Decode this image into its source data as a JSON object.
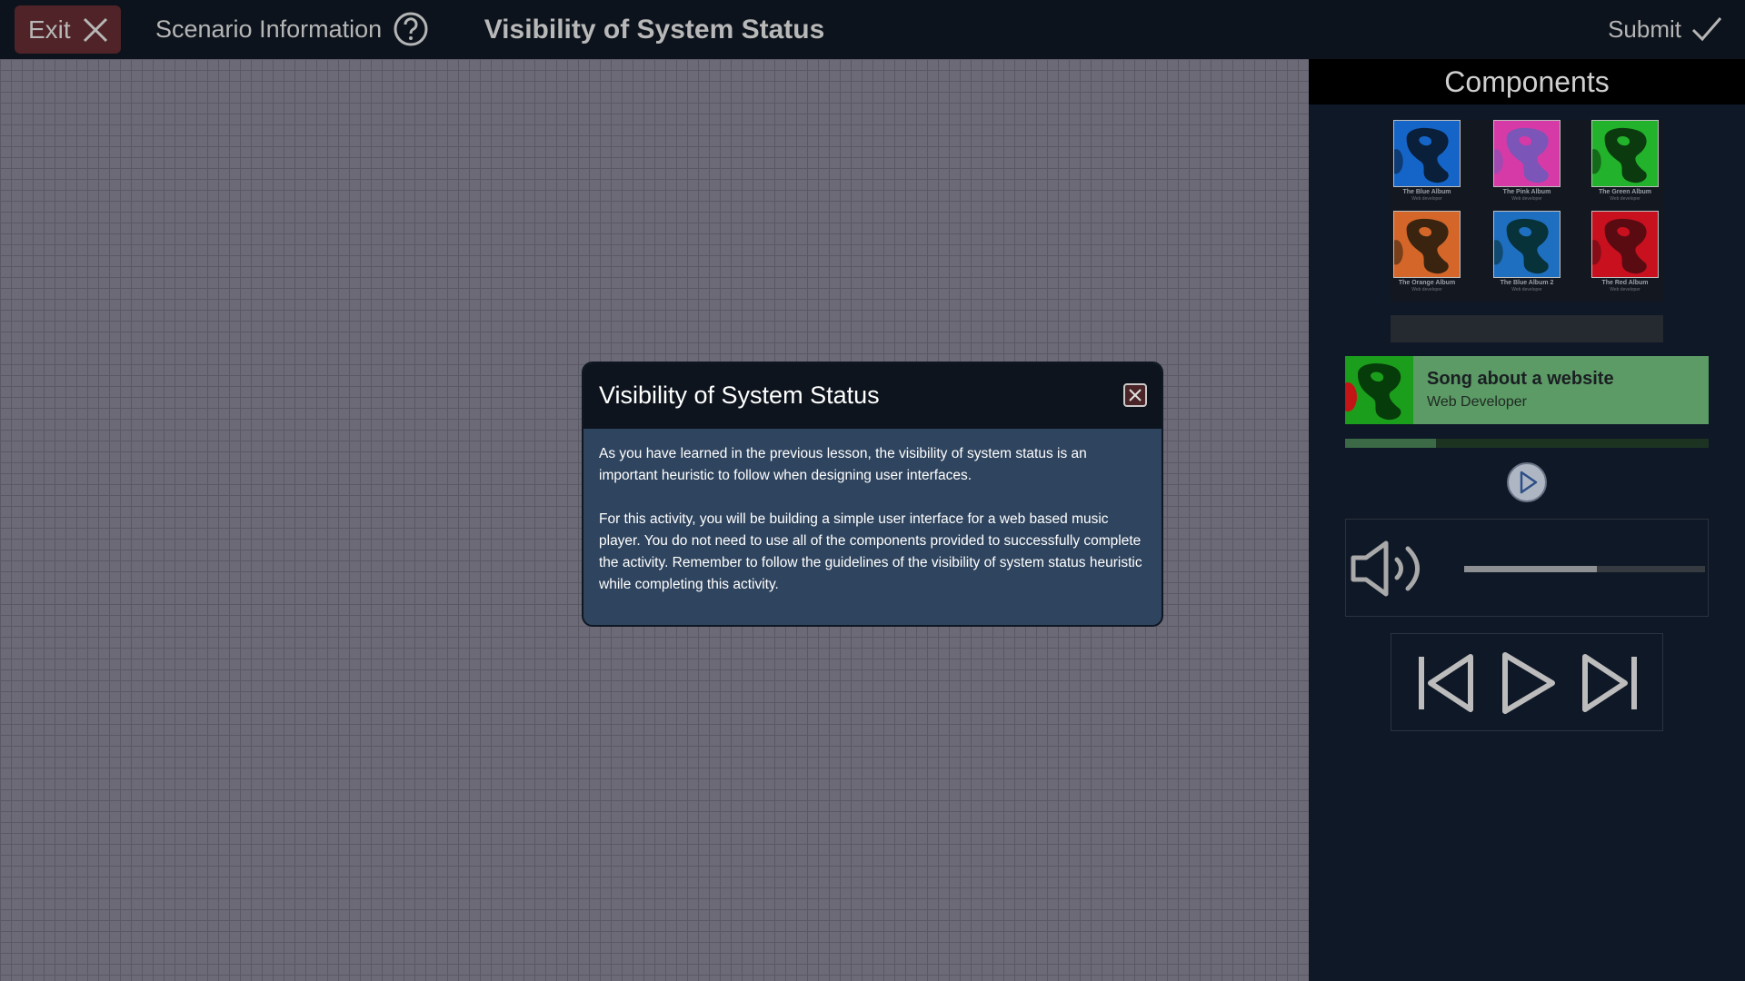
{
  "topbar": {
    "exit_label": "Exit",
    "scenario_label": "Scenario Information",
    "title": "Visibility of System Status",
    "submit_label": "Submit"
  },
  "panel": {
    "header": "Components",
    "albums": [
      {
        "title": "The Blue Album",
        "artist": "Web developer",
        "color": "#1565c8",
        "blob": "#0a1f3a"
      },
      {
        "title": "The Pink Album",
        "artist": "Web developer",
        "color": "#d63aa7",
        "blob": "#7b55b8"
      },
      {
        "title": "The Green Album",
        "artist": "Web developer",
        "color": "#22b22b",
        "blob": "#0a3a0e"
      },
      {
        "title": "The Orange Album",
        "artist": "Web developer",
        "color": "#d4662a",
        "blob": "#3a2410"
      },
      {
        "title": "The Blue Album 2",
        "artist": "Web developer",
        "color": "#1f6fc0",
        "blob": "#08323a"
      },
      {
        "title": "The Red Album",
        "artist": "Web developer",
        "color": "#c8101f",
        "blob": "#5a0b12"
      }
    ],
    "now_playing": {
      "title": "Song about a website",
      "artist": "Web Developer",
      "progress": 0.25
    },
    "volume_level": 0.55
  },
  "modal": {
    "title": "Visibility of System Status",
    "paragraph1": "As you have learned in the previous lesson, the visibility of system status is an important heuristic to follow when designing user interfaces.",
    "paragraph2": "For this activity, you will be building a simple user interface for a web based music player. You do not need to use all of the components provided to successfully complete the activity. Remember to follow the guidelines of the visibility of system status heuristic while completing this activity."
  }
}
